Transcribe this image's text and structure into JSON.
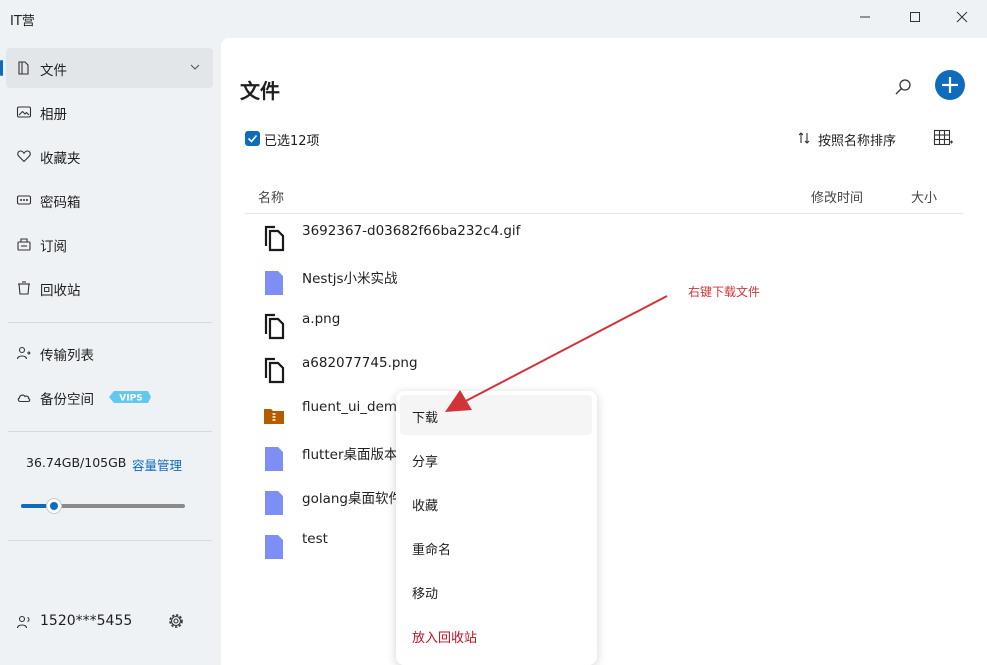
{
  "window": {
    "title": "IT营"
  },
  "sidebar": {
    "items": [
      {
        "label": "文件",
        "icon": "file-icon"
      },
      {
        "label": "相册",
        "icon": "album-icon"
      },
      {
        "label": "收藏夹",
        "icon": "heart-icon"
      },
      {
        "label": "密码箱",
        "icon": "password-icon"
      },
      {
        "label": "订阅",
        "icon": "subscribe-icon"
      },
      {
        "label": "回收站",
        "icon": "recycle-bin-icon"
      },
      {
        "label": "传输列表",
        "icon": "transfer-icon"
      },
      {
        "label": "备份空间",
        "icon": "cloud-icon"
      }
    ],
    "vip_badge": "VIPS",
    "storage": {
      "usage": "36.74GB/105GB",
      "manage_label": "容量管理",
      "used_fraction": 0.2
    },
    "user": {
      "name": "1520***5455"
    }
  },
  "main": {
    "title": "文件",
    "selected_label": "已选12项",
    "sort_label": "按照名称排序",
    "columns": {
      "name": "名称",
      "modified": "修改时间",
      "size": "大小"
    },
    "files": [
      {
        "name": "3692367-d03682f66ba232c4.gif",
        "type": "doc"
      },
      {
        "name": "Nestjs小米实战",
        "type": "folder"
      },
      {
        "name": "a.png",
        "type": "doc"
      },
      {
        "name": "a682077745.png",
        "type": "doc"
      },
      {
        "name": "fluent_ui_dem",
        "type": "zip"
      },
      {
        "name": "flutter桌面版本",
        "type": "folder"
      },
      {
        "name": "golang桌面软件",
        "type": "folder"
      },
      {
        "name": "test",
        "type": "folder"
      }
    ]
  },
  "context_menu": {
    "items": [
      {
        "label": "下载"
      },
      {
        "label": "分享"
      },
      {
        "label": "收藏"
      },
      {
        "label": "重命名"
      },
      {
        "label": "移动"
      },
      {
        "label": "放入回收站"
      }
    ]
  },
  "annotation": {
    "text": "右键下载文件"
  },
  "colors": {
    "accent": "#0f6cbd",
    "danger": "#c50f1f",
    "annotation": "#d13438",
    "folder": "#7d8ff5",
    "zip": "#b35c00"
  }
}
